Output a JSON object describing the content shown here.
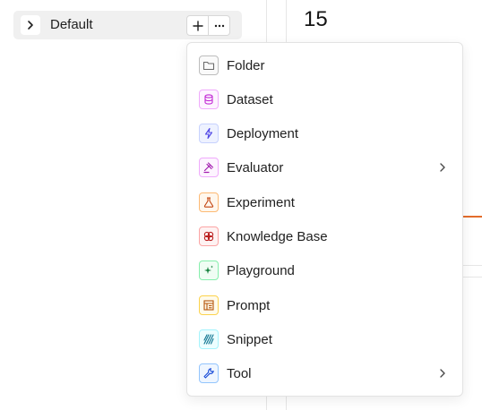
{
  "sidebar": {
    "project": {
      "label": "Default"
    },
    "actions": {
      "add_icon": "plus-icon",
      "more_icon": "ellipsis-icon"
    }
  },
  "main": {
    "count": "15"
  },
  "menu": {
    "items": [
      {
        "label": "Folder",
        "icon": "folder-icon",
        "color": "#6b6b6b",
        "has_submenu": false
      },
      {
        "label": "Dataset",
        "icon": "database-icon",
        "color": "#c026d3",
        "has_submenu": false
      },
      {
        "label": "Deployment",
        "icon": "lightning-icon",
        "color": "#4f46e5",
        "has_submenu": false
      },
      {
        "label": "Evaluator",
        "icon": "gavel-icon",
        "color": "#a21caf",
        "has_submenu": true
      },
      {
        "label": "Experiment",
        "icon": "flask-icon",
        "color": "#c2410c",
        "has_submenu": false
      },
      {
        "label": "Knowledge Base",
        "icon": "brain-icon",
        "color": "#b91c1c",
        "has_submenu": false
      },
      {
        "label": "Playground",
        "icon": "sparkle-icon",
        "color": "#15803d",
        "has_submenu": false
      },
      {
        "label": "Prompt",
        "icon": "document-icon",
        "color": "#b45309",
        "has_submenu": false
      },
      {
        "label": "Snippet",
        "icon": "stripes-icon",
        "color": "#0e7490",
        "has_submenu": false
      },
      {
        "label": "Tool",
        "icon": "wrench-icon",
        "color": "#1d4ed8",
        "has_submenu": true
      }
    ]
  }
}
